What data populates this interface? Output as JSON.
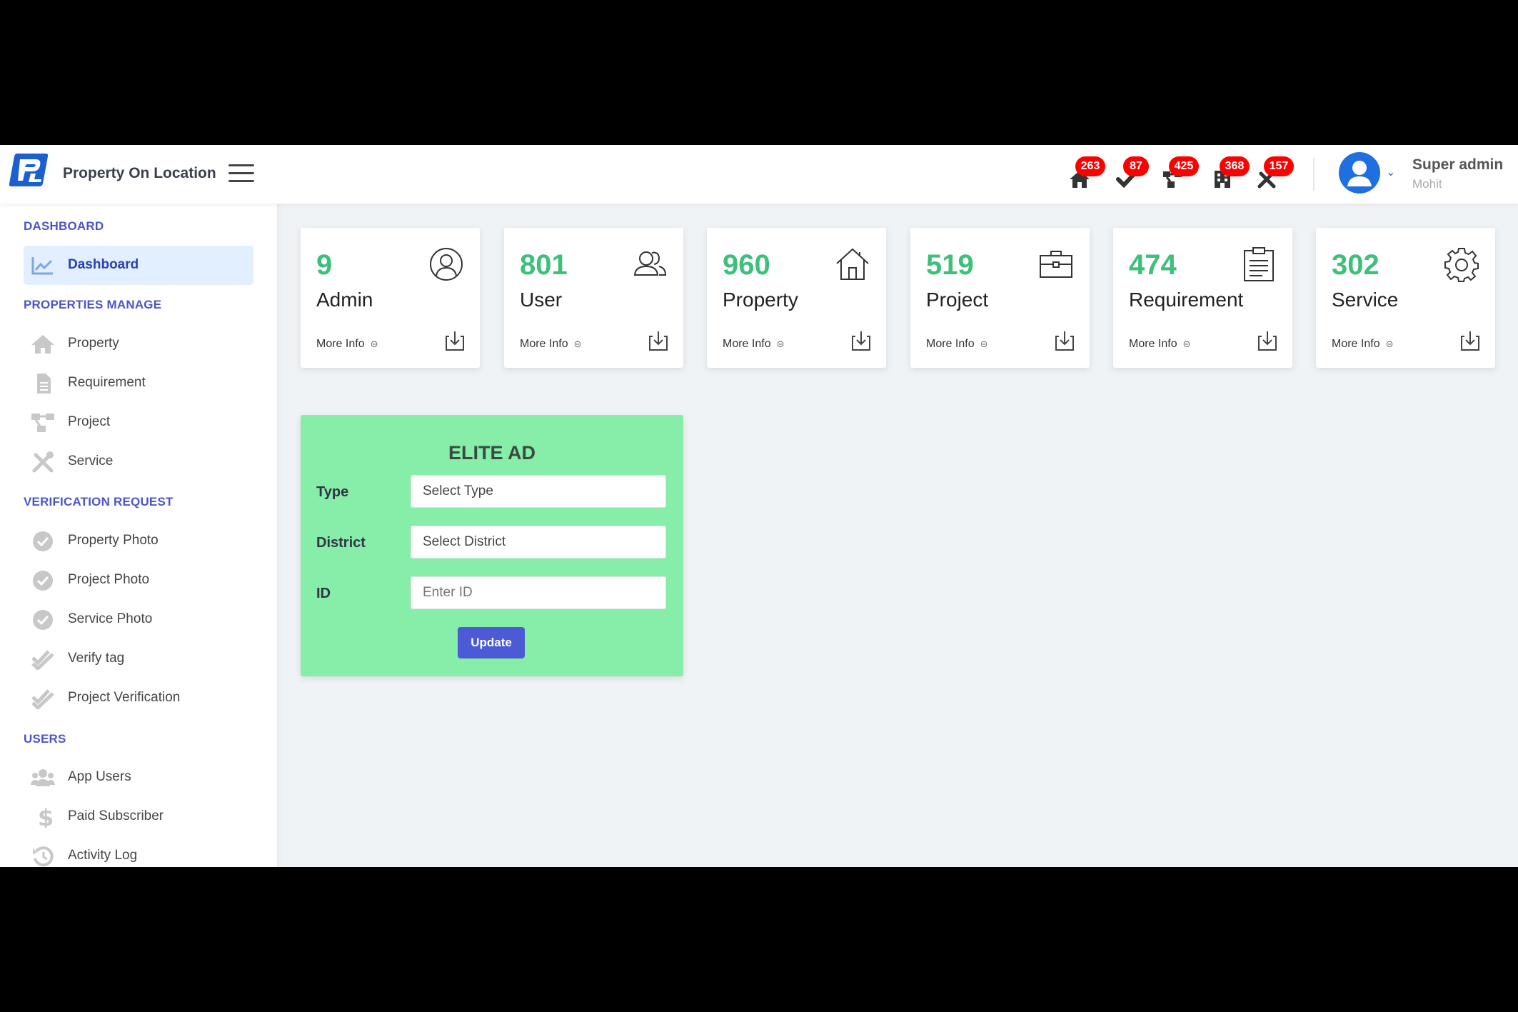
{
  "header": {
    "brand": "Property On Location",
    "notifications": [
      {
        "icon": "home-icon",
        "count": "263"
      },
      {
        "icon": "check-icon",
        "count": "87"
      },
      {
        "icon": "project-icon",
        "count": "425"
      },
      {
        "icon": "building-icon",
        "count": "368"
      },
      {
        "icon": "tools-icon",
        "count": "157"
      }
    ],
    "user": {
      "name": "Super admin",
      "sub": "Mohit"
    }
  },
  "sidebar": {
    "sections": [
      {
        "title": "DASHBOARD"
      },
      {
        "title": "PROPERTIES MANAGE"
      },
      {
        "title": "VERIFICATION REQUEST"
      },
      {
        "title": "USERS"
      }
    ],
    "items": [
      {
        "label": "Dashboard",
        "icon": "chart-icon",
        "active": true
      },
      {
        "label": "Property",
        "icon": "home-icon"
      },
      {
        "label": "Requirement",
        "icon": "file-icon"
      },
      {
        "label": "Project",
        "icon": "project-icon"
      },
      {
        "label": "Service",
        "icon": "tools-icon"
      },
      {
        "label": "Property Photo",
        "icon": "check-circle-icon"
      },
      {
        "label": "Project Photo",
        "icon": "check-circle-icon"
      },
      {
        "label": "Service Photo",
        "icon": "check-circle-icon"
      },
      {
        "label": "Verify tag",
        "icon": "double-check-icon"
      },
      {
        "label": "Project Verification",
        "icon": "double-check-icon"
      },
      {
        "label": "App Users",
        "icon": "users-icon"
      },
      {
        "label": "Paid Subscriber",
        "icon": "dollar-icon"
      },
      {
        "label": "Activity Log",
        "icon": "history-icon"
      }
    ]
  },
  "cards": [
    {
      "count": "9",
      "title": "Admin",
      "more": "More Info",
      "icon": "user-circle-icon"
    },
    {
      "count": "801",
      "title": "User",
      "more": "More Info",
      "icon": "users-icon"
    },
    {
      "count": "960",
      "title": "Property",
      "more": "More Info",
      "icon": "house-icon"
    },
    {
      "count": "519",
      "title": "Project",
      "more": "More Info",
      "icon": "briefcase-icon"
    },
    {
      "count": "474",
      "title": "Requirement",
      "more": "More Info",
      "icon": "clipboard-icon"
    },
    {
      "count": "302",
      "title": "Service",
      "more": "More Info",
      "icon": "gear-icon"
    }
  ],
  "elite_ad": {
    "title": "ELITE AD",
    "type_label": "Type",
    "type_value": "Select Type",
    "district_label": "District",
    "district_value": "Select District",
    "id_label": "ID",
    "id_placeholder": "Enter ID",
    "button": "Update"
  },
  "colors": {
    "accent": "#4b55c8",
    "count_green": "#3cc07a",
    "elite_bg": "#86eea9",
    "badge_red": "#ff0000",
    "button": "#4d5ad6"
  }
}
